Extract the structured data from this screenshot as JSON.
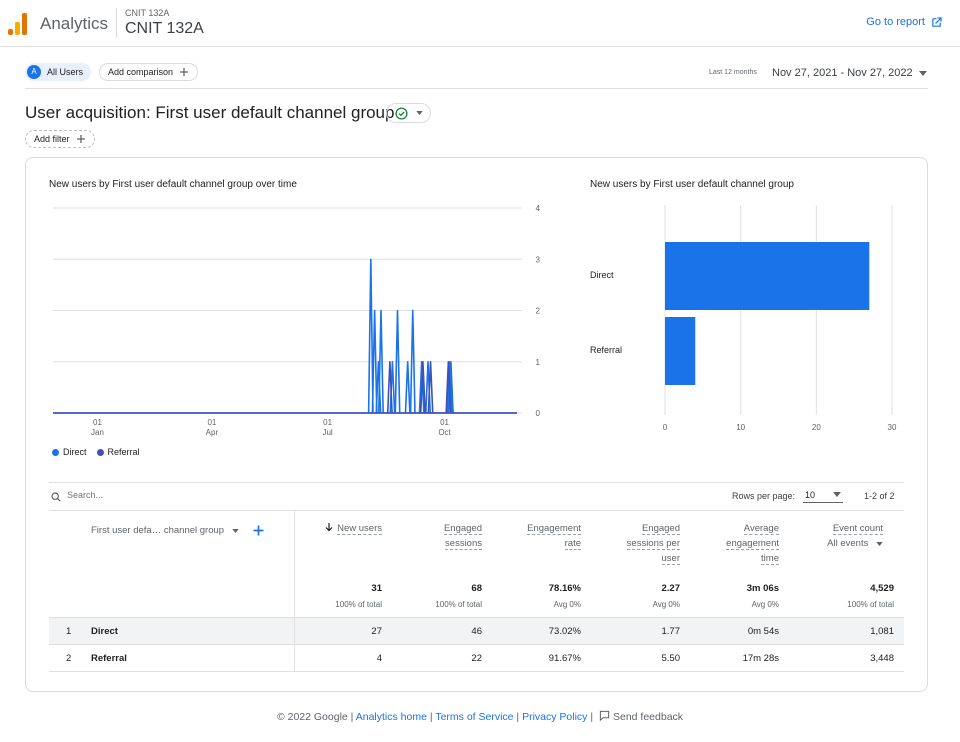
{
  "header": {
    "app_name": "Analytics",
    "property_small": "CNIT 132A",
    "property_name": "CNIT 132A",
    "go_to_report": "Go to report"
  },
  "comparison": {
    "segment_initial": "A",
    "segment_label": "All Users",
    "add_comparison": "Add comparison"
  },
  "date": {
    "preset": "Last 12 months",
    "range": "Nov 27, 2021 - Nov 27, 2022"
  },
  "page": {
    "title": "User acquisition: First user default channel group",
    "add_filter": "Add filter"
  },
  "colors": {
    "direct": "#1a73e8",
    "referral": "#3f51b5",
    "accent": "#1a73e8"
  },
  "line_chart_title": "New users by First user default channel group over time",
  "bar_chart_title": "New users by First user default channel group",
  "legend": {
    "direct": "Direct",
    "referral": "Referral"
  },
  "chart_data": [
    {
      "type": "line",
      "title": "New users by First user default channel group over time",
      "x_ticks": [
        {
          "line1": "01",
          "line2": "Jan"
        },
        {
          "line1": "01",
          "line2": "Apr"
        },
        {
          "line1": "01",
          "line2": "Jul"
        },
        {
          "line1": "01",
          "line2": "Oct"
        }
      ],
      "ylim": [
        0,
        4
      ],
      "y_ticks": [
        "4",
        "3",
        "2",
        "1",
        "0"
      ],
      "x_range_days": [
        0,
        365
      ],
      "series": [
        {
          "name": "Direct",
          "points": [
            {
              "day": 250,
              "value": 3
            },
            {
              "day": 253,
              "value": 2
            },
            {
              "day": 256,
              "value": 1
            },
            {
              "day": 258,
              "value": 2
            },
            {
              "day": 267,
              "value": 1
            },
            {
              "day": 271,
              "value": 2
            },
            {
              "day": 279,
              "value": 1
            },
            {
              "day": 283,
              "value": 2
            },
            {
              "day": 290,
              "value": 1
            },
            {
              "day": 295,
              "value": 1
            },
            {
              "day": 312,
              "value": 1
            },
            {
              "day": 313,
              "value": 1
            }
          ]
        },
        {
          "name": "Referral",
          "points": [
            {
              "day": 265,
              "value": 1
            },
            {
              "day": 291,
              "value": 1
            },
            {
              "day": 297,
              "value": 1
            },
            {
              "day": 311,
              "value": 1
            }
          ]
        }
      ]
    },
    {
      "type": "bar",
      "orientation": "horizontal",
      "title": "New users by First user default channel group",
      "categories": [
        "Direct",
        "Referral"
      ],
      "values": [
        27,
        4
      ],
      "xlim": [
        0,
        30
      ],
      "x_ticks": [
        "0",
        "10",
        "20",
        "30"
      ]
    }
  ],
  "table": {
    "search_placeholder": "Search...",
    "rows_per_page_label": "Rows per page:",
    "rows_per_page": "10",
    "pager": "1-2 of 2",
    "dimension_header": "First user defa… channel group",
    "columns": [
      {
        "l1": "New users",
        "l2": "",
        "l3": ""
      },
      {
        "l1": "Engaged",
        "l2": "sessions",
        "l3": ""
      },
      {
        "l1": "Engagement",
        "l2": "rate",
        "l3": ""
      },
      {
        "l1": "Engaged",
        "l2": "sessions per",
        "l3": "user"
      },
      {
        "l1": "Average",
        "l2": "engagement",
        "l3": "time"
      },
      {
        "l1": "Event count",
        "l2": "All events",
        "l3": ""
      }
    ],
    "totals": [
      "31",
      "68",
      "78.16%",
      "2.27",
      "3m 06s",
      "4,529"
    ],
    "totals_sub": [
      "100% of total",
      "100% of total",
      "Avg 0%",
      "Avg 0%",
      "Avg 0%",
      "100% of total"
    ],
    "rows": [
      {
        "idx": "1",
        "name": "Direct",
        "values": [
          "27",
          "46",
          "73.02%",
          "1.77",
          "0m 54s",
          "1,081"
        ]
      },
      {
        "idx": "2",
        "name": "Referral",
        "values": [
          "4",
          "22",
          "91.67%",
          "5.50",
          "17m 28s",
          "3,448"
        ]
      }
    ]
  },
  "footer": {
    "copyright": "© 2022 Google |",
    "link1": "Analytics home",
    "link2": "Terms of Service",
    "link3": "Privacy Policy",
    "feedback": "Send feedback"
  }
}
